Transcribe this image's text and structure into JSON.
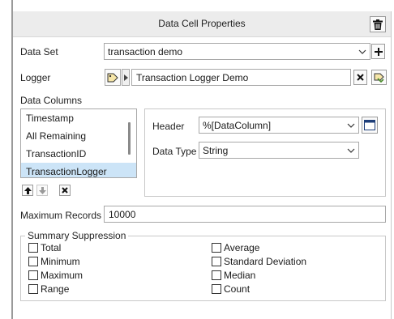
{
  "panel": {
    "title": "Data Cell Properties"
  },
  "data_set": {
    "label": "Data Set",
    "value": "transaction demo"
  },
  "logger": {
    "label": "Logger",
    "value": "Transaction Logger Demo"
  },
  "data_columns": {
    "label": "Data Columns",
    "items": [
      "Timestamp",
      "All Remaining",
      "TransactionID",
      "TransactionLogger"
    ],
    "selected_index": 3
  },
  "column_props": {
    "header_label": "Header",
    "header_value": "%[DataColumn]",
    "data_type_label": "Data Type",
    "data_type_value": "String"
  },
  "max_records": {
    "label": "Maximum Records",
    "value": "10000"
  },
  "summary_suppression": {
    "legend": "Summary Suppression",
    "left": [
      "Total",
      "Minimum",
      "Maximum",
      "Range"
    ],
    "right": [
      "Average",
      "Standard Deviation",
      "Median",
      "Count"
    ]
  },
  "icons": {
    "trash": "trash-icon",
    "add": "plus-icon",
    "tag": "tag-icon",
    "expand": "triangle-right-icon",
    "clear": "close-icon",
    "browse": "tag-browse-icon",
    "move_up": "arrow-up-icon",
    "move_down": "arrow-down-icon",
    "remove": "close-icon",
    "binding": "window-icon",
    "chevron": "chevron-down-icon"
  },
  "colors": {
    "selection": "#cce4f7",
    "title_bar": "#ececec",
    "binding_accent": "#1f3f7a",
    "tag_fill": "#f6e6a8"
  }
}
